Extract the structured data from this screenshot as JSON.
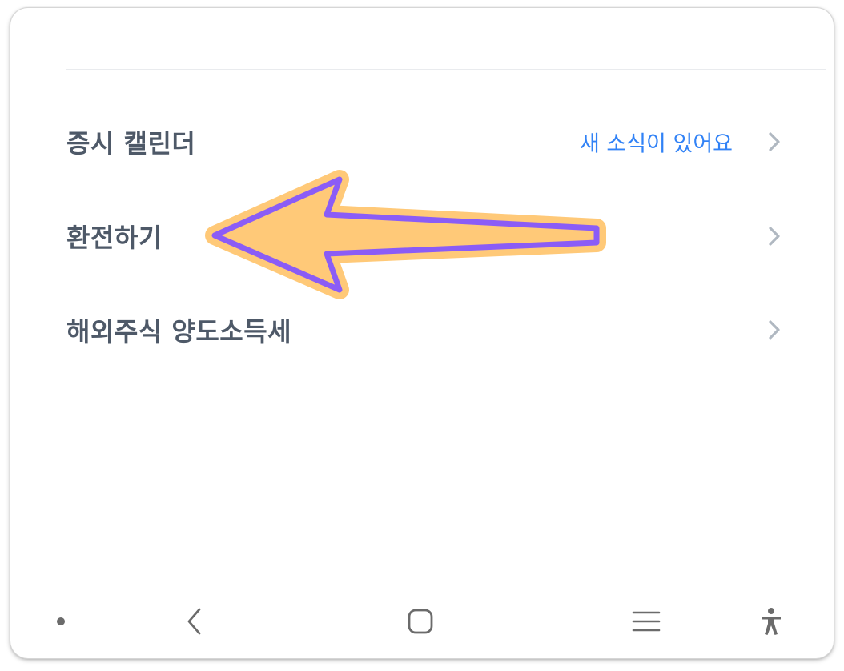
{
  "menu": {
    "items": [
      {
        "label": "증시 캘린더",
        "badge": "새 소식이 있어요",
        "icon": "chevron-right-icon"
      },
      {
        "label": "환전하기",
        "badge": "",
        "icon": "chevron-right-icon"
      },
      {
        "label": "해외주식 양도소득세",
        "badge": "",
        "icon": "chevron-right-icon"
      }
    ]
  },
  "annotation": {
    "icon": "left-arrow-annotation",
    "fill_color": "#ffc978",
    "stroke_color": "#8b5cf6"
  },
  "navbar": {
    "items": [
      {
        "icon": "dot-icon"
      },
      {
        "icon": "back-icon"
      },
      {
        "icon": "home-icon"
      },
      {
        "icon": "recent-apps-icon"
      },
      {
        "icon": "accessibility-icon"
      }
    ]
  },
  "colors": {
    "label": "#4e5968",
    "badge": "#3182f6",
    "chevron": "#b0b8c1",
    "nav_icon": "#6b6b6b"
  }
}
